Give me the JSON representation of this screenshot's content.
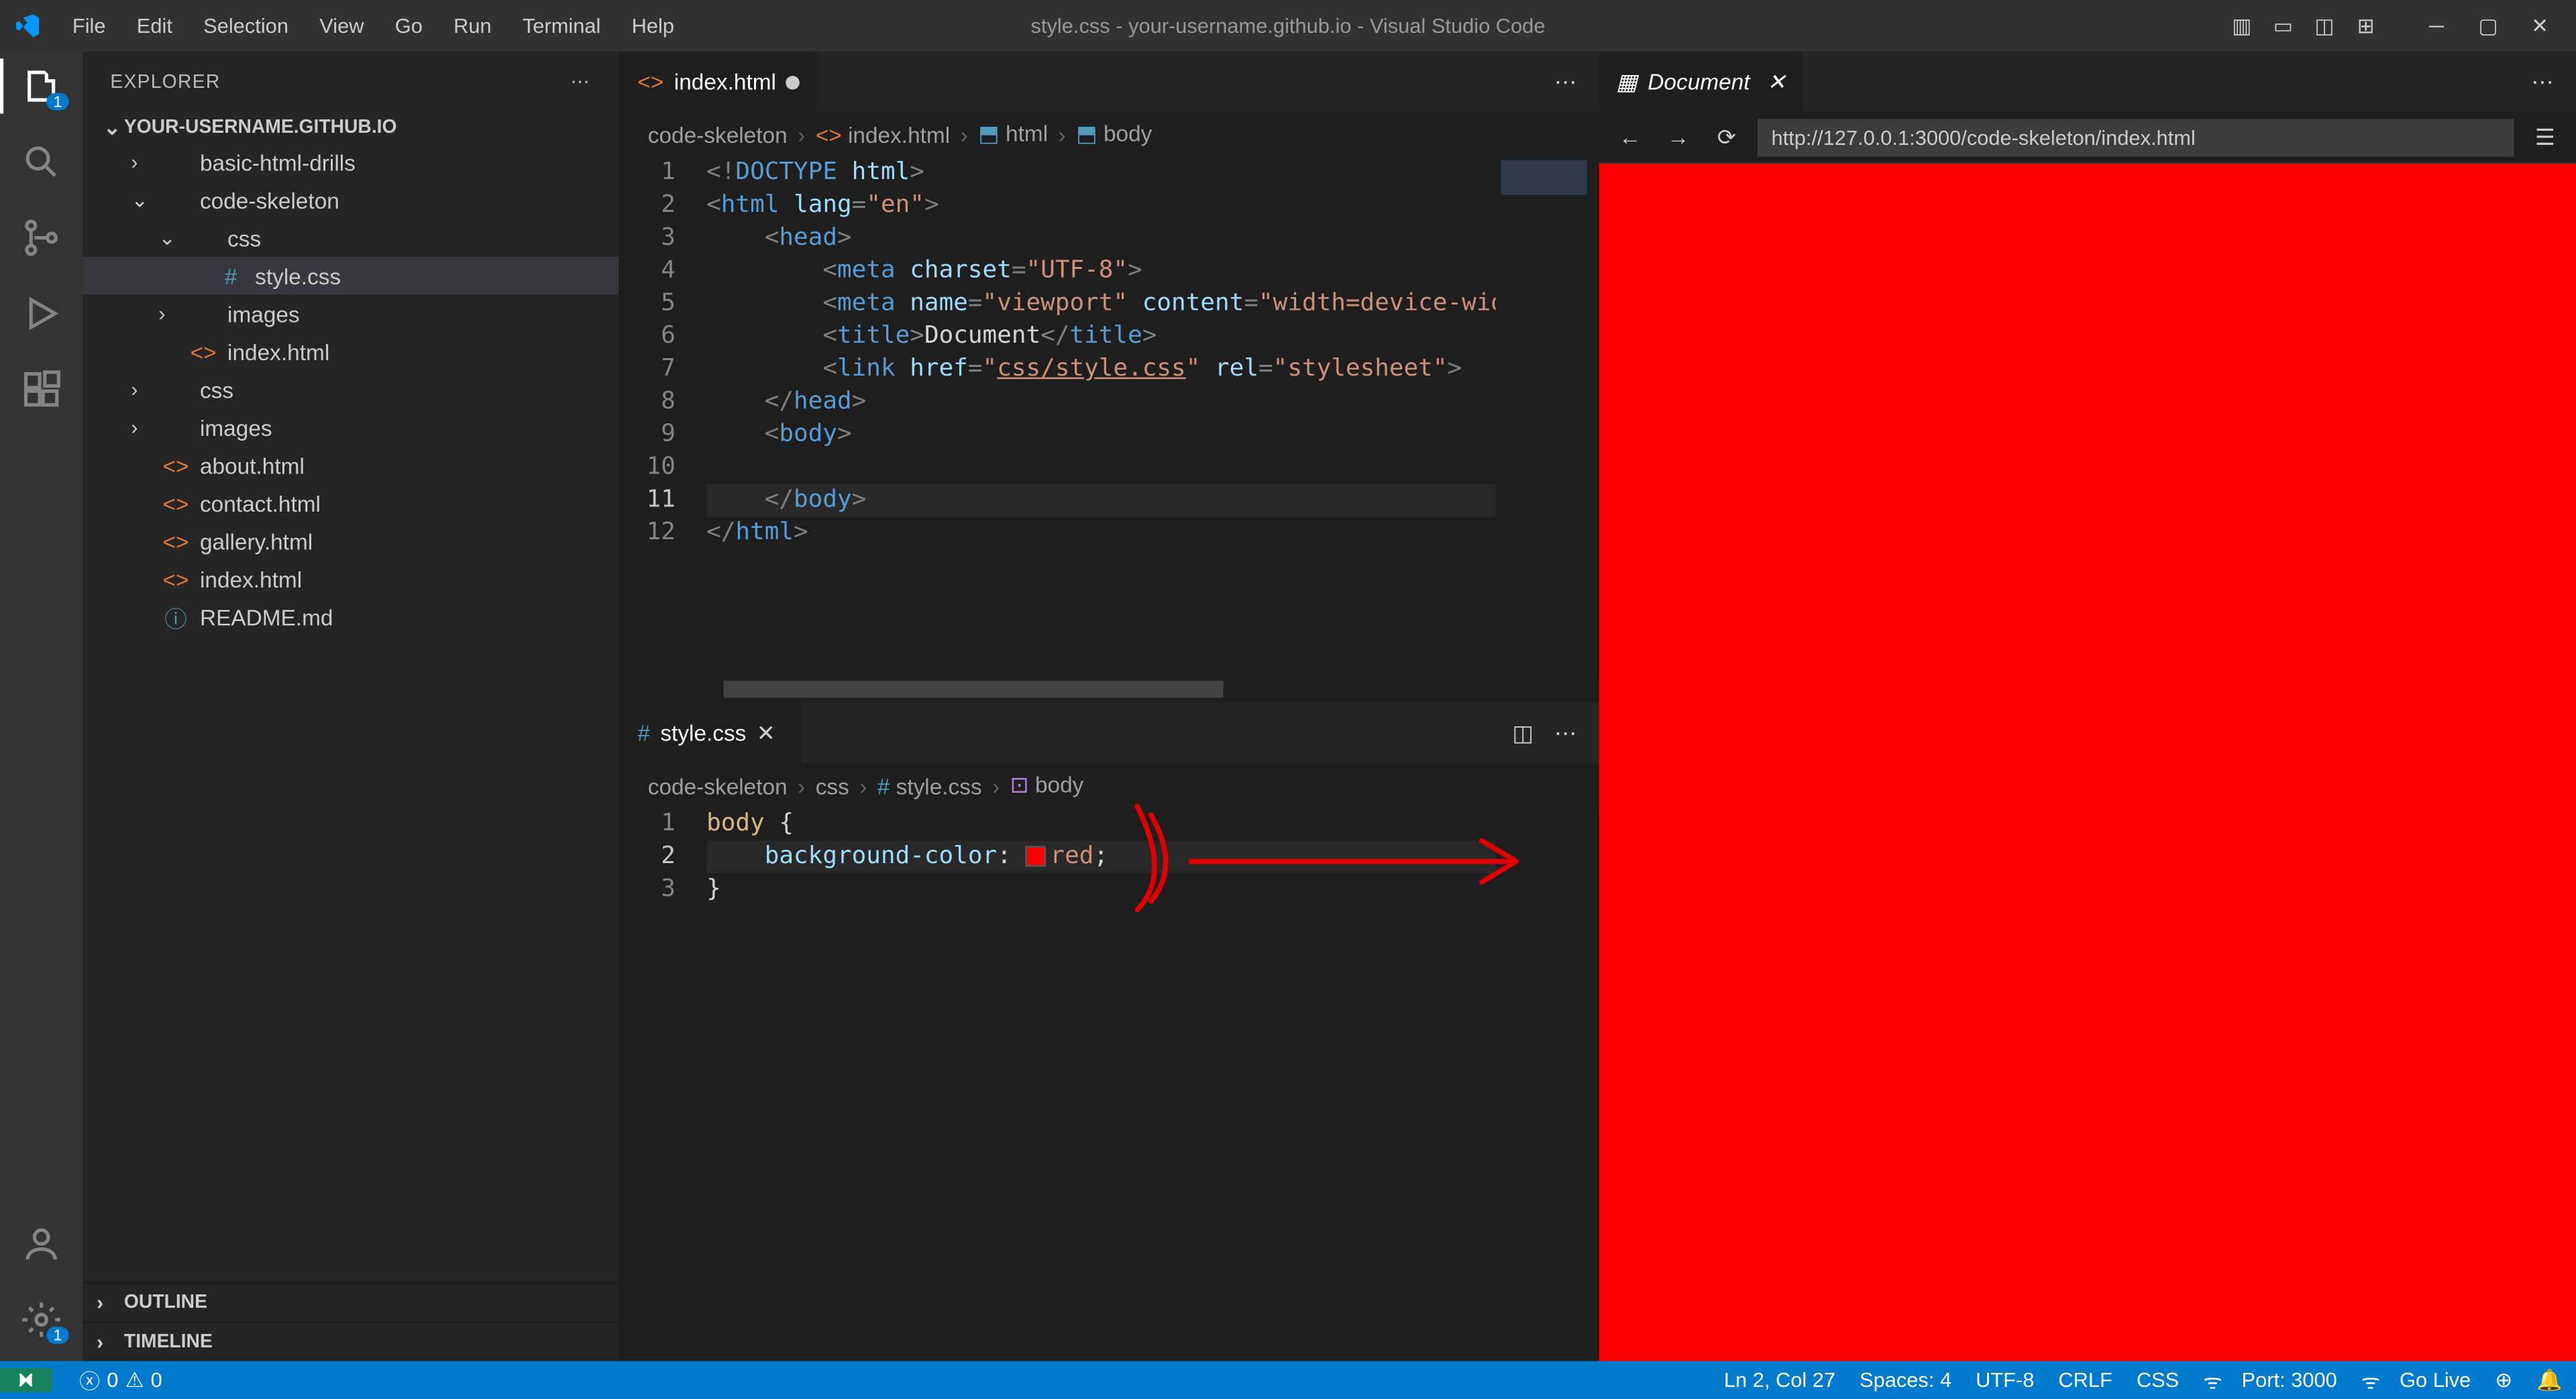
{
  "titlebar": {
    "menus": [
      "File",
      "Edit",
      "Selection",
      "View",
      "Go",
      "Run",
      "Terminal",
      "Help"
    ],
    "title": "style.css - your-username.github.io - Visual Studio Code"
  },
  "explorer": {
    "title": "EXPLORER",
    "root": "YOUR-USERNAME.GITHUB.IO",
    "tree": [
      {
        "label": "basic-html-drills",
        "type": "folder",
        "indent": 1,
        "expanded": false
      },
      {
        "label": "code-skeleton",
        "type": "folder",
        "indent": 1,
        "expanded": true
      },
      {
        "label": "css",
        "type": "folder",
        "indent": 2,
        "expanded": true
      },
      {
        "label": "style.css",
        "type": "css",
        "indent": 3,
        "selected": true
      },
      {
        "label": "images",
        "type": "folder",
        "indent": 2,
        "expanded": false
      },
      {
        "label": "index.html",
        "type": "html",
        "indent": 2
      },
      {
        "label": "css",
        "type": "folder",
        "indent": 1,
        "expanded": false
      },
      {
        "label": "images",
        "type": "folder",
        "indent": 1,
        "expanded": false
      },
      {
        "label": "about.html",
        "type": "html",
        "indent": 1
      },
      {
        "label": "contact.html",
        "type": "html",
        "indent": 1
      },
      {
        "label": "gallery.html",
        "type": "html",
        "indent": 1
      },
      {
        "label": "index.html",
        "type": "html",
        "indent": 1
      },
      {
        "label": "README.md",
        "type": "md",
        "indent": 1
      }
    ],
    "outline": "OUTLINE",
    "timeline": "TIMELINE"
  },
  "editorTop": {
    "tab": {
      "label": "index.html",
      "dirty": true
    },
    "breadcrumb": [
      "code-skeleton",
      "index.html",
      "html",
      "body"
    ],
    "lineCount": 12,
    "activeLine": 11,
    "code": [
      {
        "html": "<span class='punct'>&lt;!</span><span class='tag'>DOCTYPE</span> <span class='attr'>html</span><span class='punct'>&gt;</span>"
      },
      {
        "html": "<span class='punct'>&lt;</span><span class='tag'>html</span> <span class='attr'>lang</span><span class='punct'>=</span><span class='str'>\"en\"</span><span class='punct'>&gt;</span>"
      },
      {
        "html": "    <span class='punct'>&lt;</span><span class='tag'>head</span><span class='punct'>&gt;</span>"
      },
      {
        "html": "        <span class='punct'>&lt;</span><span class='tag'>meta</span> <span class='attr'>charset</span><span class='punct'>=</span><span class='str'>\"UTF-8\"</span><span class='punct'>&gt;</span>"
      },
      {
        "html": "        <span class='punct'>&lt;</span><span class='tag'>meta</span> <span class='attr'>name</span><span class='punct'>=</span><span class='str'>\"viewport\"</span> <span class='attr'>content</span><span class='punct'>=</span><span class='str'>\"width=device-widt</span>"
      },
      {
        "html": "        <span class='punct'>&lt;</span><span class='tag'>title</span><span class='punct'>&gt;</span><span class='text'>Document</span><span class='punct'>&lt;/</span><span class='tag'>title</span><span class='punct'>&gt;</span>"
      },
      {
        "html": "        <span class='punct'>&lt;</span><span class='tag'>link</span> <span class='attr'>href</span><span class='punct'>=</span><span class='str'>\"<u>css/style.css</u>\"</span> <span class='attr'>rel</span><span class='punct'>=</span><span class='str'>\"stylesheet\"</span><span class='punct'>&gt;</span>"
      },
      {
        "html": "    <span class='punct'>&lt;/</span><span class='tag'>head</span><span class='punct'>&gt;</span>"
      },
      {
        "html": "    <span class='punct'>&lt;</span><span class='tag'>body</span><span class='punct'>&gt;</span>"
      },
      {
        "html": ""
      },
      {
        "html": "    <span class='punct'>&lt;/</span><span class='tag'>body</span><span class='punct'>&gt;</span>",
        "active": true
      },
      {
        "html": "<span class='punct'>&lt;/</span><span class='tag'>html</span><span class='punct'>&gt;</span>"
      }
    ]
  },
  "editorBottom": {
    "tab": {
      "label": "style.css"
    },
    "breadcrumb": [
      "code-skeleton",
      "css",
      "style.css",
      "body"
    ],
    "lineCount": 3,
    "activeLine": 2,
    "code": [
      {
        "html": "<span class='sel'>body</span> <span class='brace'>{</span>"
      },
      {
        "html": "    <span class='prop'>background-color</span><span class='text'>:</span> <span class='color-swatch'></span><span class='val'>red</span><span class='text'>;</span>",
        "active": true
      },
      {
        "html": "<span class='brace'>}</span>"
      }
    ]
  },
  "preview": {
    "tab": "Document",
    "url": "http://127.0.0.1:3000/code-skeleton/index.html"
  },
  "statusbar": {
    "errors": "0",
    "warnings": "0",
    "cursor": "Ln 2, Col 27",
    "spaces": "Spaces: 4",
    "encoding": "UTF-8",
    "eol": "CRLF",
    "lang": "CSS",
    "port": "Port: 3000",
    "live": "Go Live"
  }
}
